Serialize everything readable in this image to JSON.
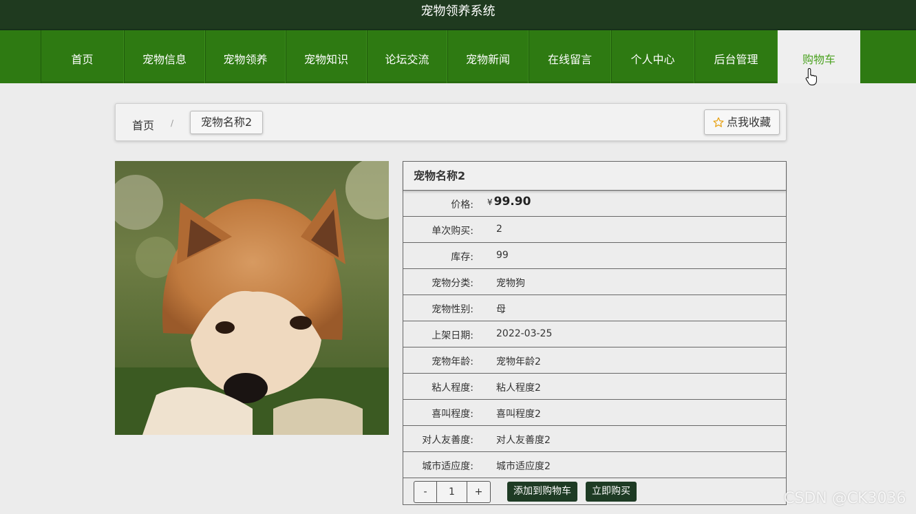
{
  "app": {
    "title": "宠物领养系统"
  },
  "nav": {
    "items": [
      {
        "label": "首页"
      },
      {
        "label": "宠物信息"
      },
      {
        "label": "宠物领养"
      },
      {
        "label": "宠物知识"
      },
      {
        "label": "论坛交流"
      },
      {
        "label": "宠物新闻"
      },
      {
        "label": "在线留言"
      },
      {
        "label": "个人中心"
      },
      {
        "label": "后台管理"
      },
      {
        "label": "购物车"
      }
    ],
    "active": "购物车"
  },
  "breadcrumb": {
    "home": "首页",
    "separator": "/",
    "current": "宠物名称2"
  },
  "favorite": {
    "label": "点我收藏",
    "icon": "star-icon"
  },
  "detail": {
    "title": "宠物名称2",
    "price_label": "价格:",
    "currency": "¥",
    "price": "99.90",
    "rows": [
      {
        "key": "单次购买:",
        "value": "2"
      },
      {
        "key": "库存:",
        "value": "99"
      },
      {
        "key": "宠物分类:",
        "value": "宠物狗"
      },
      {
        "key": "宠物性别:",
        "value": "母"
      },
      {
        "key": "上架日期:",
        "value": "2022-03-25"
      },
      {
        "key": "宠物年龄:",
        "value": "宠物年龄2"
      },
      {
        "key": "粘人程度:",
        "value": "粘人程度2"
      },
      {
        "key": "喜叫程度:",
        "value": "喜叫程度2"
      },
      {
        "key": "对人友善度:",
        "value": "对人友善度2"
      },
      {
        "key": "城市适应度:",
        "value": "城市适应度2"
      }
    ]
  },
  "actions": {
    "minus": "-",
    "quantity": "1",
    "plus": "+",
    "add_to_cart": "添加到购物车",
    "buy_now": "立即购买"
  },
  "watermark": "CSDN @CK3036",
  "colors": {
    "nav_green": "#2e7a12",
    "header_dark": "#1f3a1f",
    "button_dark": "#1e3b24",
    "active_text": "#4aa11f",
    "star": "#e8a317"
  }
}
